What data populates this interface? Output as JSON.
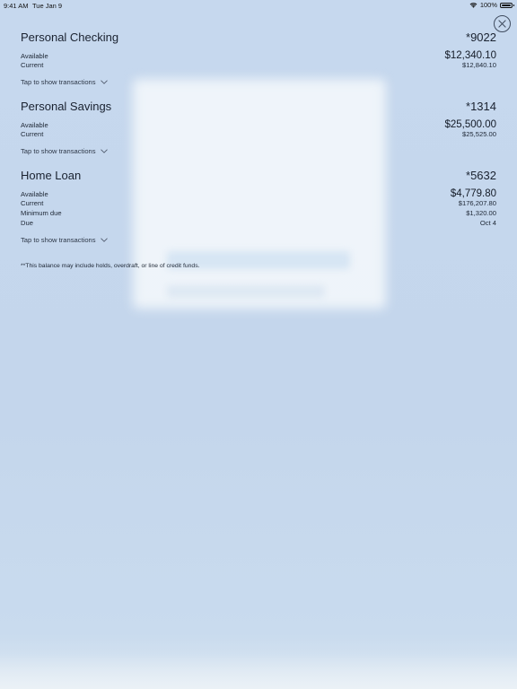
{
  "status_bar": {
    "time": "9:41 AM",
    "date": "Tue Jan 9",
    "battery": "100%"
  },
  "accounts": [
    {
      "name": "Personal Checking",
      "number": "*9022",
      "rows": [
        {
          "label": "Available",
          "value": "$12,340.10"
        },
        {
          "label": "Current",
          "value": "$12,840.10"
        }
      ],
      "tap_label": "Tap to show transactions"
    },
    {
      "name": "Personal Savings",
      "number": "*1314",
      "rows": [
        {
          "label": "Available",
          "value": "$25,500.00"
        },
        {
          "label": "Current",
          "value": "$25,525.00"
        }
      ],
      "tap_label": "Tap to show transactions"
    },
    {
      "name": "Home Loan",
      "number": "*5632",
      "rows": [
        {
          "label": "Available",
          "value": "$4,779.80"
        },
        {
          "label": "Current",
          "value": "$176,207.80"
        },
        {
          "label": "Minimum due",
          "value": "$1,320.00"
        },
        {
          "label": "Due",
          "value": "Oct 4"
        }
      ],
      "tap_label": "Tap to show transactions"
    }
  ],
  "footnote": "**This balance may include holds, overdraft, or line of credit funds.",
  "icons": {
    "close": "close-icon",
    "chevron": "chevron-down-icon",
    "wifi": "wifi-icon",
    "battery": "battery-icon"
  },
  "colors": {
    "background": "#c7d8ed",
    "text": "#1a2230"
  }
}
